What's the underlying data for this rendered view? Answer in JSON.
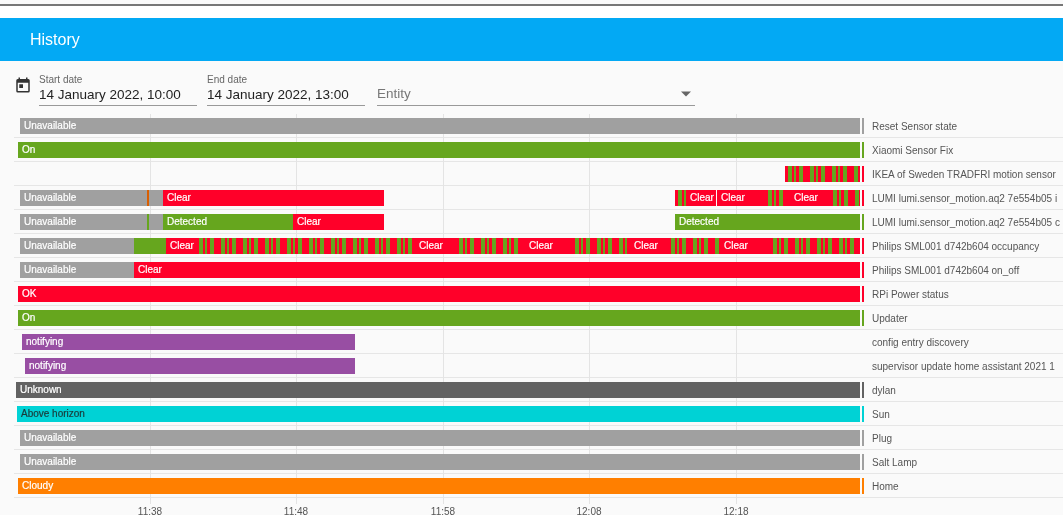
{
  "header": {
    "title": "History"
  },
  "filters": {
    "start_date": {
      "label": "Start date",
      "value": "14 January 2022, 10:00"
    },
    "end_date": {
      "label": "End date",
      "value": "14 January 2022, 13:00"
    },
    "entity": {
      "placeholder": "Entity"
    }
  },
  "timeline": {
    "ticks": [
      "11:38",
      "11:48",
      "11:58",
      "12:08",
      "12:18"
    ],
    "rows": [
      {
        "entity": "Reset Sensor state",
        "color": "#a0a0a0",
        "segments": [
          {
            "label": "Unavailable",
            "color": "#a0a0a0"
          }
        ]
      },
      {
        "entity": "Xiaomi Sensor Fix",
        "color": "#66a61e",
        "segments": [
          {
            "label": "On",
            "color": "#66a61e"
          }
        ]
      },
      {
        "entity": "IKEA of Sweden TRADFRI motion sensor",
        "color": "#ff0029",
        "segments": [
          {
            "kind": "striped",
            "color": "#ff0029",
            "stripe": {
              "color": "#66a61e"
            }
          }
        ]
      },
      {
        "entity": "LUMI lumi.sensor_motion.aq2 7e554b05 i",
        "color": "#ff0029",
        "segments": [
          {
            "label": "Unavailable",
            "color": "#a0a0a0"
          },
          {
            "color": "#d95f02"
          },
          {
            "color": "#a0a0a0"
          },
          {
            "label": "Clear",
            "color": "#ff0029"
          },
          {
            "kind": "striped",
            "color": "#ff0029",
            "stripe": {
              "color": "#66a61e"
            }
          },
          {
            "label": "Clear",
            "color": "#ff0029"
          },
          {
            "label": "Clear",
            "color": "#ff0029"
          },
          {
            "kind": "striped",
            "color": "#ff0029",
            "stripe": {
              "color": "#66a61e"
            }
          },
          {
            "label": "Clear",
            "color": "#ff0029"
          },
          {
            "kind": "striped",
            "color": "#ff0029",
            "stripe": {
              "color": "#66a61e"
            }
          }
        ]
      },
      {
        "entity": "LUMI lumi.sensor_motion.aq2 7e554b05 c",
        "color": "#66a61e",
        "segments": [
          {
            "label": "Unavailable",
            "color": "#a0a0a0"
          },
          {
            "color": "#66a61e"
          },
          {
            "color": "#a0a0a0"
          },
          {
            "label": "Detected",
            "color": "#66a61e"
          },
          {
            "label": "Clear",
            "color": "#ff0029"
          },
          {
            "label": "Detected",
            "color": "#66a61e"
          }
        ]
      },
      {
        "entity": "Philips SML001 d742b604 occupancy",
        "color": "#ff0029",
        "segments": [
          {
            "label": "Unavailable",
            "color": "#a0a0a0"
          },
          {
            "color": "#66a61e"
          },
          {
            "label": "Clear",
            "color": "#ff0029"
          },
          {
            "kind": "striped",
            "color": "#ff0029",
            "stripe": {
              "color": "#66a61e"
            }
          },
          {
            "label": "Clear",
            "color": "#ff0029"
          },
          {
            "kind": "striped",
            "color": "#ff0029",
            "stripe": {
              "color": "#66a61e"
            }
          },
          {
            "label": "Clear",
            "color": "#ff0029"
          },
          {
            "kind": "striped",
            "color": "#ff0029",
            "stripe": {
              "color": "#66a61e"
            }
          },
          {
            "label": "Clear",
            "color": "#ff0029"
          },
          {
            "kind": "striped",
            "color": "#ff0029",
            "stripe": {
              "color": "#66a61e"
            }
          },
          {
            "label": "Clear",
            "color": "#ff0029"
          },
          {
            "kind": "striped",
            "color": "#ff0029",
            "stripe": {
              "color": "#66a61e"
            }
          }
        ]
      },
      {
        "entity": "Philips SML001 d742b604 on_off",
        "color": "#ff0029",
        "segments": [
          {
            "label": "Unavailable",
            "color": "#a0a0a0"
          },
          {
            "label": "Clear",
            "color": "#ff0029"
          }
        ]
      },
      {
        "entity": "RPi Power status",
        "color": "#ff0029",
        "segments": [
          {
            "label": "OK",
            "color": "#ff0029"
          }
        ]
      },
      {
        "entity": "Updater",
        "color": "#66a61e",
        "segments": [
          {
            "label": "On",
            "color": "#66a61e"
          }
        ]
      },
      {
        "entity": "config entry discovery",
        "segments": [
          {
            "label": "notifying",
            "color": "#984ea3"
          }
        ]
      },
      {
        "entity": "supervisor update home assistant 2021 1",
        "segments": [
          {
            "label": "notifying",
            "color": "#984ea3"
          }
        ]
      },
      {
        "entity": "dylan",
        "color": "#626262",
        "segments": [
          {
            "label": "Unknown",
            "color": "#626262"
          }
        ]
      },
      {
        "entity": "Sun",
        "color": "#00d2d5",
        "segments": [
          {
            "label": "Above horizon",
            "color": "#00d2d5"
          }
        ]
      },
      {
        "entity": "Plug",
        "color": "#a0a0a0",
        "segments": [
          {
            "label": "Unavailable",
            "color": "#a0a0a0"
          }
        ]
      },
      {
        "entity": "Salt Lamp",
        "color": "#a0a0a0",
        "segments": [
          {
            "label": "Unavailable",
            "color": "#a0a0a0"
          }
        ]
      },
      {
        "entity": "Home",
        "color": "#ff7f00",
        "segments": [
          {
            "label": "Cloudy",
            "color": "#ff7f00"
          }
        ]
      }
    ]
  }
}
